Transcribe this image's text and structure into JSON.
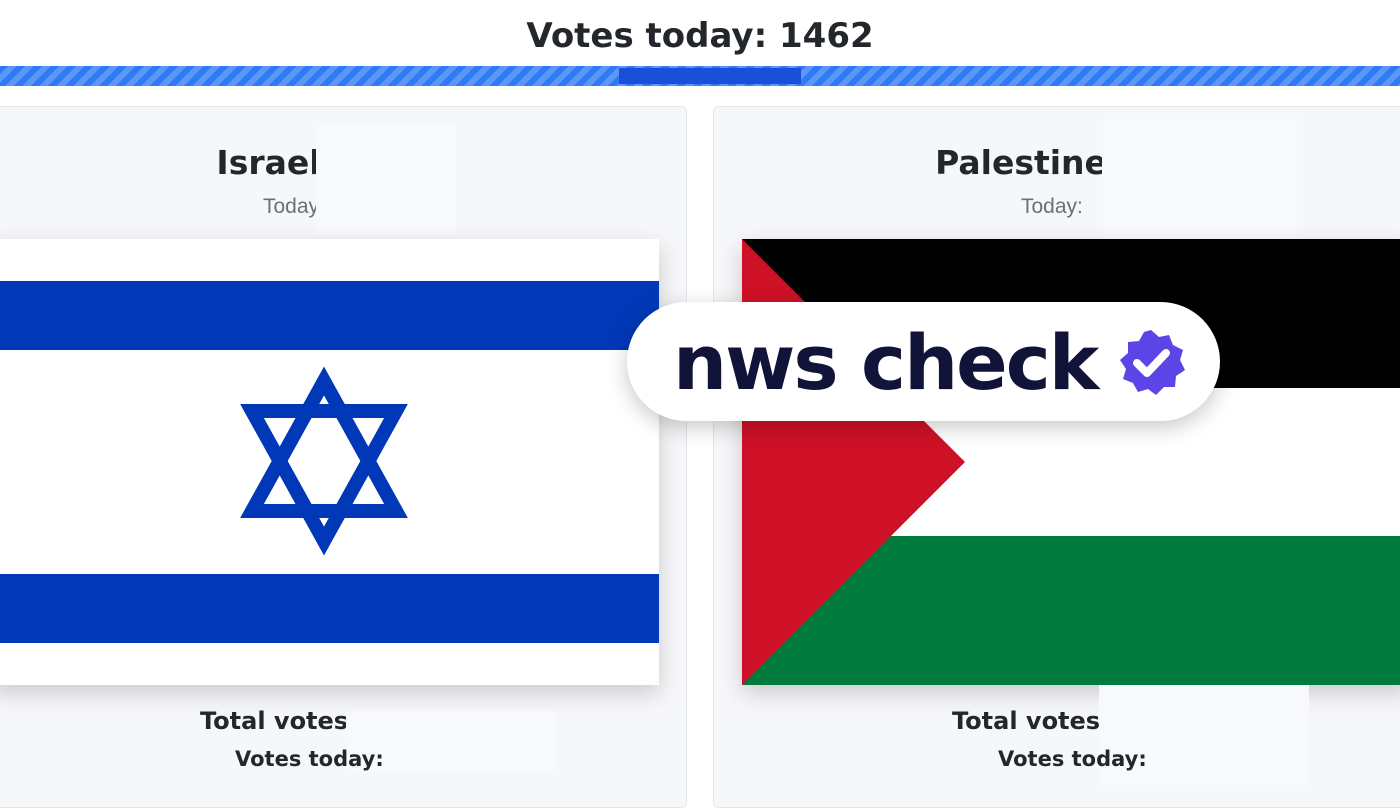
{
  "header": {
    "votes_today_label": "Votes today: 1462"
  },
  "progress": {
    "today_share": 0.13
  },
  "cards": [
    {
      "country": "Israel",
      "today_label": "Today:",
      "total_votes_label": "Total votes:",
      "votes_today_label": "Votes today:"
    },
    {
      "country": "Palestine",
      "today_label": "Today:",
      "total_votes_label": "Total votes:",
      "votes_today_label": "Votes today:"
    }
  ],
  "watermark": {
    "text": "nws check",
    "icon": "verified-check-icon"
  },
  "colors": {
    "israel_blue": "#0038b8",
    "palestine_red": "#ce1126",
    "palestine_green": "#007a3d",
    "progress_blue": "#2f7bf6",
    "badge_purple": "#5b45e6"
  }
}
